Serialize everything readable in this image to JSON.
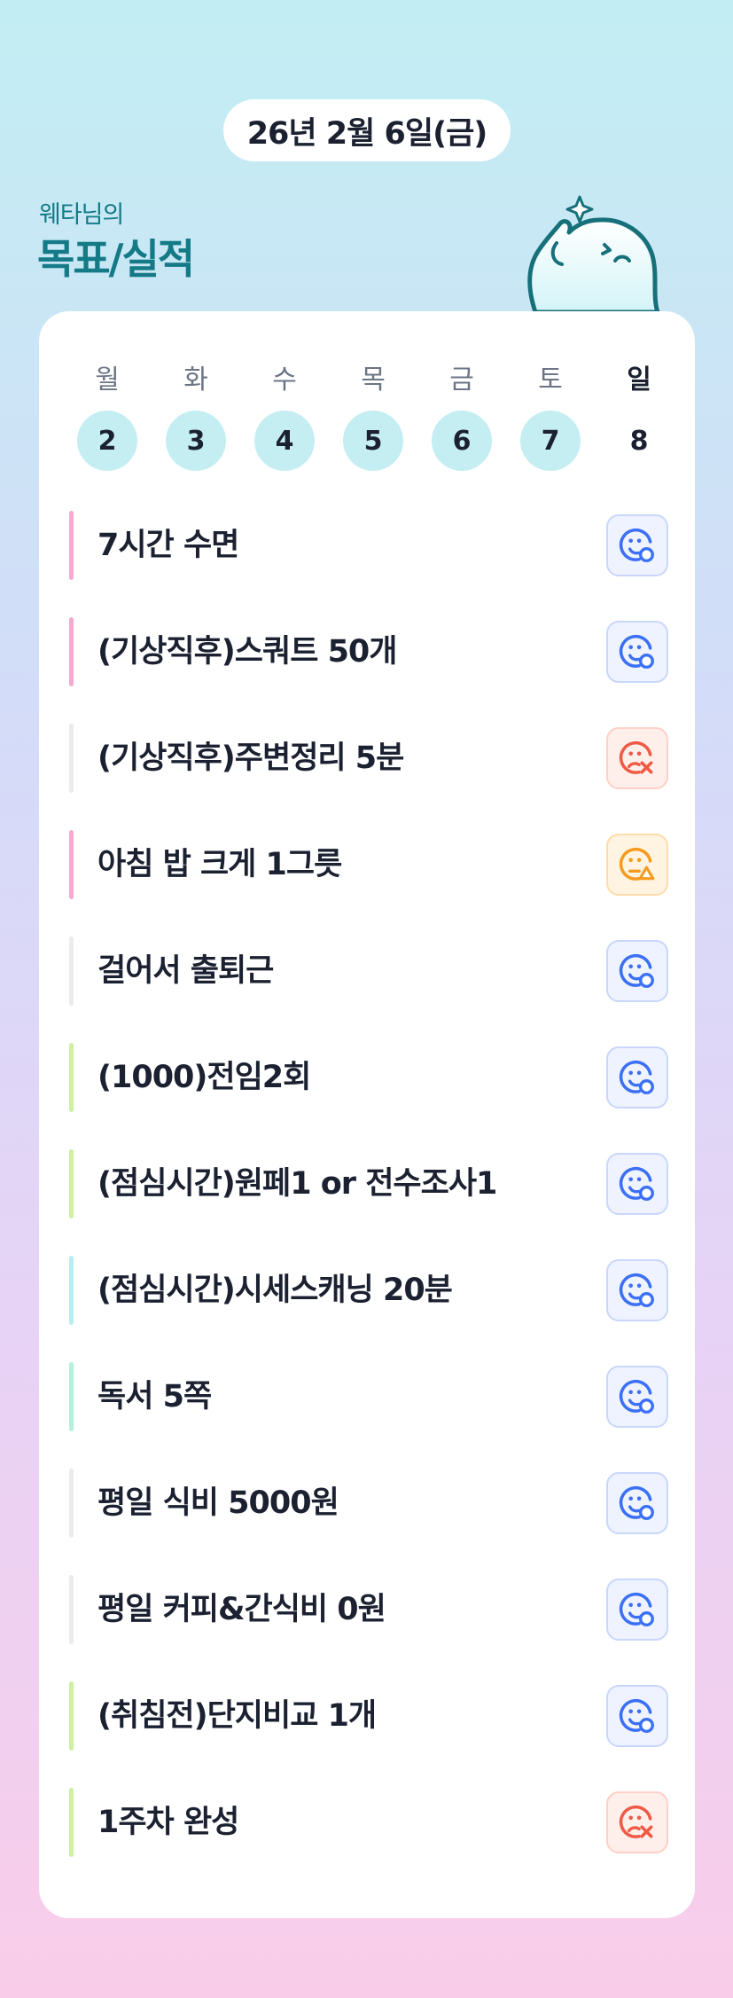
{
  "header": {
    "date": "26년 2월 6일(금)",
    "owner": "웨타님의",
    "title": "목표/실적"
  },
  "colors": {
    "accent_teal": "#137a86",
    "done_circle": "#c5eef3",
    "status_good": "#3b6ff5",
    "status_bad": "#ef5a45",
    "status_mid": "#f59b1f"
  },
  "week": [
    {
      "label": "월",
      "date": "2",
      "done": true
    },
    {
      "label": "화",
      "date": "3",
      "done": true
    },
    {
      "label": "수",
      "date": "4",
      "done": true
    },
    {
      "label": "목",
      "date": "5",
      "done": true
    },
    {
      "label": "금",
      "date": "6",
      "done": true
    },
    {
      "label": "토",
      "date": "7",
      "done": true
    },
    {
      "label": "일",
      "date": "8",
      "done": false
    }
  ],
  "goals": [
    {
      "text": "7시간 수면",
      "bar_color": "#f7a9d2",
      "status": "good"
    },
    {
      "text": "(기상직후)스쿼트 50개",
      "bar_color": "#f7a9d2",
      "status": "good"
    },
    {
      "text": "(기상직후)주변정리 5분",
      "bar_color": "#e9ebef",
      "status": "bad"
    },
    {
      "text": "아침 밥 크게 1그릇",
      "bar_color": "#f7a9d2",
      "status": "mid"
    },
    {
      "text": "걸어서 출퇴근",
      "bar_color": "#e9ebef",
      "status": "good"
    },
    {
      "text": "(1000)전임2회",
      "bar_color": "#cdf0a2",
      "status": "good"
    },
    {
      "text": "(점심시간)원페1 or 전수조사1",
      "bar_color": "#cdf0a2",
      "status": "good"
    },
    {
      "text": "(점심시간)시세스캐닝 20분",
      "bar_color": "#b8eef3",
      "status": "good"
    },
    {
      "text": "독서 5쪽",
      "bar_color": "#b5f0db",
      "status": "good"
    },
    {
      "text": "평일 식비 5000원",
      "bar_color": "#e9ebef",
      "status": "good"
    },
    {
      "text": "평일 커피&간식비 0원",
      "bar_color": "#e9ebef",
      "status": "good"
    },
    {
      "text": "(취침전)단지비교 1개",
      "bar_color": "#cdf0a2",
      "status": "good"
    },
    {
      "text": "1주차 완성",
      "bar_color": "#cdf0a2",
      "status": "bad"
    }
  ]
}
